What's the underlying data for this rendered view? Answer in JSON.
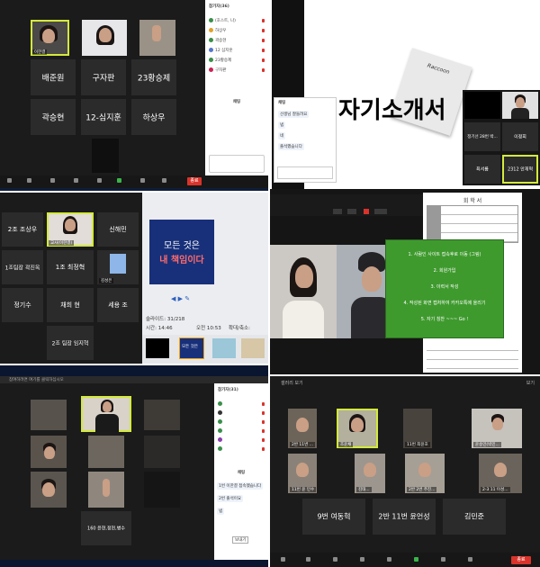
{
  "p1": {
    "names": [
      "배준원",
      "구자판",
      "23황승제",
      "곽승현",
      "12-심지훈",
      "하상우"
    ],
    "self_tag": "이한결",
    "top_tags": [
      "이한결",
      "",
      ""
    ],
    "sidebar_title": "참가자(36)",
    "sidebar_rows": [
      "(호스트, 나)",
      "하상우",
      "곽승현",
      "12 심지훈",
      "23황승제",
      "구자판"
    ],
    "chat_title": "채팅",
    "end_label": "종료"
  },
  "p2": {
    "slide_title": "자기소개서",
    "brand": "Raccoon",
    "names": [
      "정기선 28번 박...",
      "이정희",
      "최서름",
      "2312 안재혁"
    ],
    "chat_title": "채팅",
    "chat_msgs": [
      "선생님 잘들려요",
      "넵",
      "네",
      "출석했습니다"
    ]
  },
  "p3": {
    "names": [
      "2조 조상우",
      "신해민",
      "1조팀장 곽진옥",
      "1조 최정혁",
      "정기수",
      "채희 현",
      "세용 조",
      "2조 팀장 임지혁"
    ],
    "host_tag": "교사(이한결)",
    "blue_tag": "김성은",
    "slide_line1": "모든 것은",
    "slide_line2": "내 책임이다",
    "slide_counter": "슬라이드: 31/218",
    "time_label": "시간: 14:46",
    "clock_label": "오전 10:53",
    "zoom_label": "확대/축소:",
    "thumb_text": "모든 것은"
  },
  "p4": {
    "toolbar_left": "",
    "doc_title": "회 학 서",
    "green_lines": [
      "1. 사람인 사이트 접속후로 이동 (그림)",
      "2. 회원가입",
      "3. 이력서 작성",
      "4. 작성된 화면 캡처하여 카카오톡에 올리기",
      "5. 자기 칭찬 ~~~ Go !"
    ]
  },
  "p5": {
    "top_bar": "참여하려면 여기를 클릭하십시오",
    "names": [
      "",
      "",
      "",
      "",
      "",
      "",
      "",
      "",
      "",
      "160 윤현,정현,병수"
    ],
    "sidebar_title": "참가자(31)",
    "chat_title": "채팅",
    "chat_msgs": [
      "1번 이한결 접속했습니다",
      "2번 출석이요",
      "넵"
    ],
    "send_label": "보내기"
  },
  "p6": {
    "top_left": "갤러리 보기",
    "top_right": "보기",
    "names": [
      "9번 여동혁",
      "2반 11번 윤언성",
      "김민준"
    ],
    "tags": [
      "2반 11번 ...",
      "조윤채",
      "11번 최윤호",
      "윤송민(박민...",
      "11번 윤 민수",
      "김태...",
      "2반 2번 주진...",
      "2-3 11 이성..."
    ],
    "end_label": "종료"
  },
  "colors": {
    "active_border": "#d4ea3c",
    "end_red": "#d9332b",
    "slide_blue": "#18307a",
    "green_box": "#3f9a2e"
  }
}
